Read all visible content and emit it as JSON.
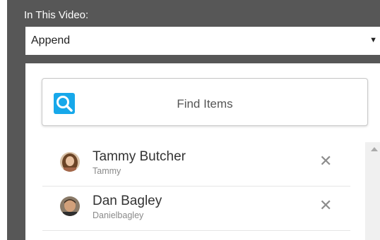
{
  "header": {
    "label": "In This Video:"
  },
  "mode_select": {
    "value": "Append"
  },
  "search": {
    "placeholder": "Find Items"
  },
  "items": [
    {
      "name": "Tammy Butcher",
      "username": "Tammy"
    },
    {
      "name": "Dan Bagley",
      "username": "Danielbagley"
    }
  ],
  "icons": {
    "search": "search-icon",
    "remove": "close-icon",
    "dropdown": "caret-down-icon",
    "scroll_up": "arrow-up-icon"
  },
  "colors": {
    "frame": "#575757",
    "accent": "#17a8ea"
  }
}
